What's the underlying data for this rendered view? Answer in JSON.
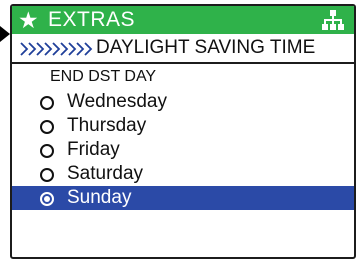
{
  "header": {
    "star_icon": "star-icon",
    "title": "EXTRAS",
    "network_icon": "network-tree-icon",
    "bar_color": "#2fb24a"
  },
  "breadcrumb": {
    "chevrons_icon": "chevrons-right-icon",
    "text": "DAYLIGHT SAVING TIME"
  },
  "section_label": "END DST DAY",
  "options": [
    {
      "label": "Wednesday",
      "selected": false
    },
    {
      "label": "Thursday",
      "selected": false
    },
    {
      "label": "Friday",
      "selected": false
    },
    {
      "label": "Saturday",
      "selected": false
    },
    {
      "label": "Sunday",
      "selected": true
    }
  ],
  "selection_color": "#2b4aa7"
}
